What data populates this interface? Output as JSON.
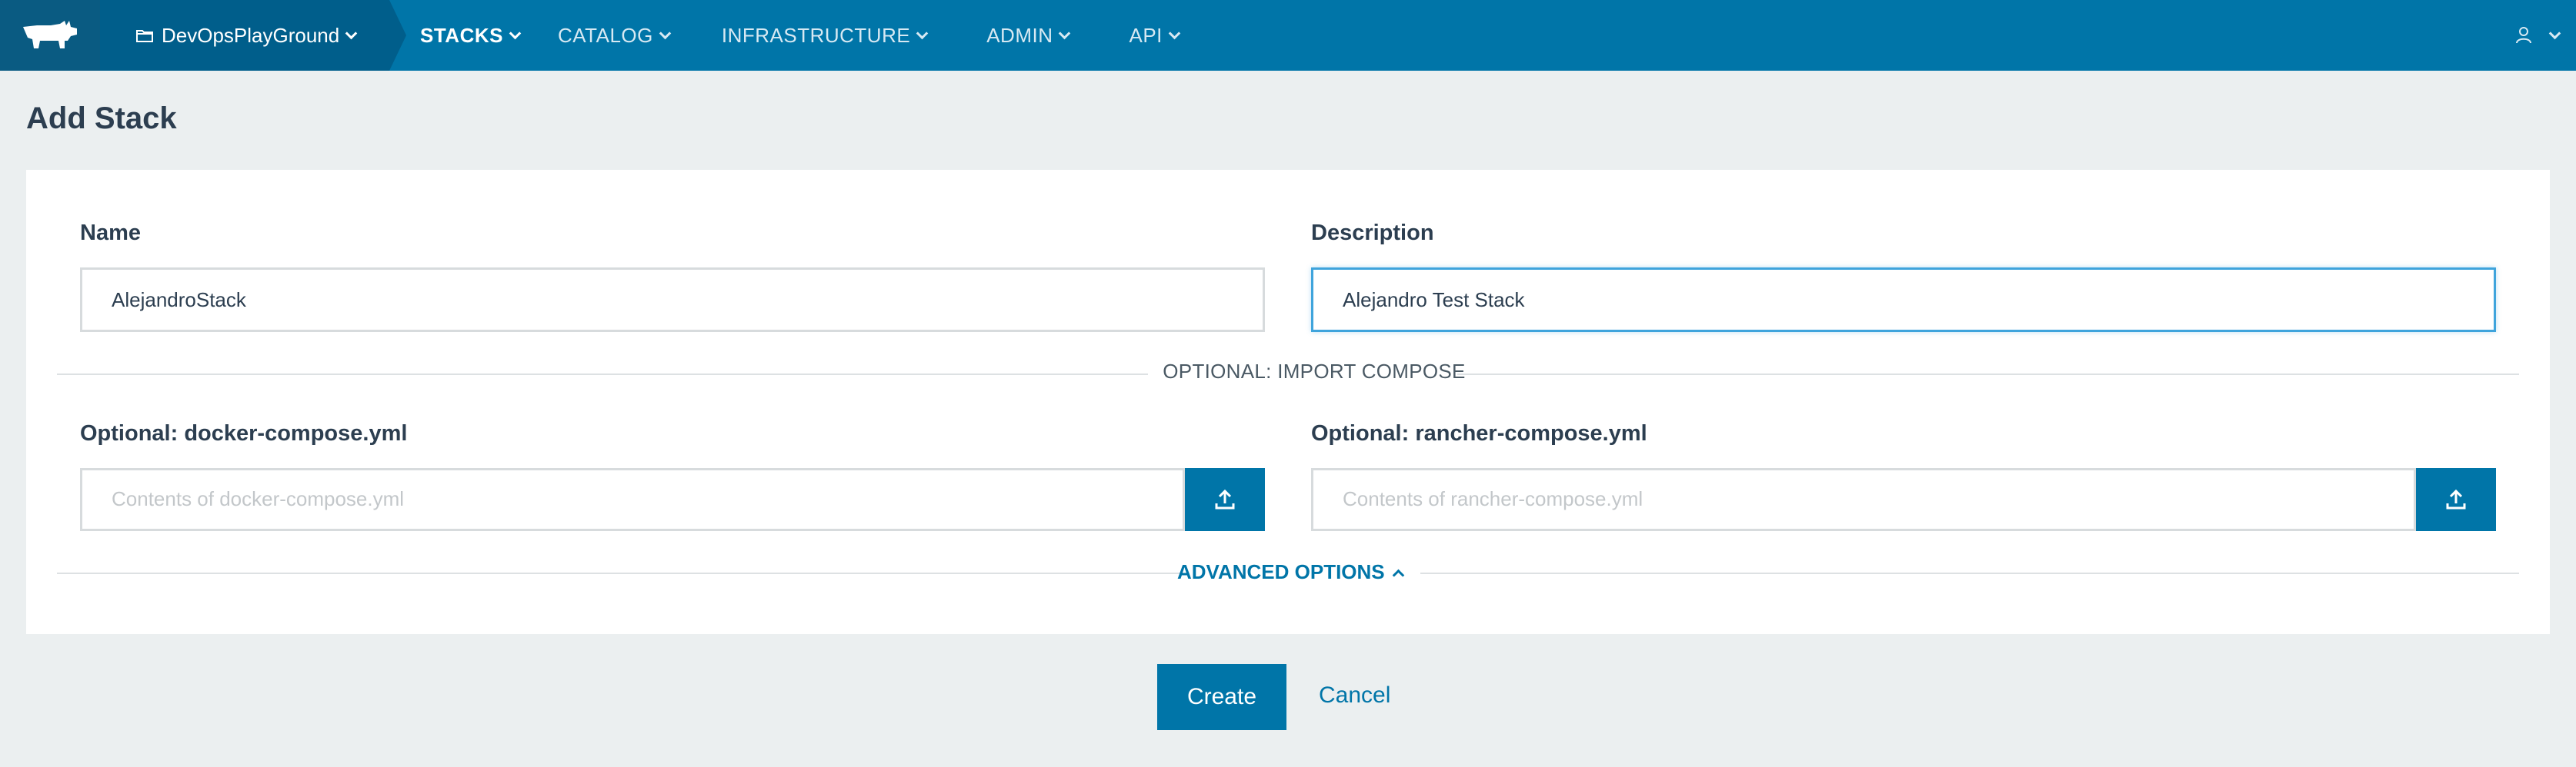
{
  "nav": {
    "environment": "DevOpsPlayGround",
    "menu": [
      {
        "label": "STACKS",
        "active": true
      },
      {
        "label": "CATALOG",
        "active": false
      },
      {
        "label": "INFRASTRUCTURE",
        "active": false
      },
      {
        "label": "ADMIN",
        "active": false
      },
      {
        "label": "API",
        "active": false
      }
    ],
    "colors": {
      "bar": "#0075a8",
      "env": "#005e8b",
      "logo": "#0a5b82"
    }
  },
  "page": {
    "title": "Add Stack"
  },
  "form": {
    "name": {
      "label": "Name",
      "value": "AlejandroStack"
    },
    "description": {
      "label": "Description",
      "value": "Alejandro Test Stack"
    },
    "import_divider": "OPTIONAL: IMPORT COMPOSE",
    "docker_compose": {
      "label": "Optional: docker-compose.yml",
      "placeholder": "Contents of docker-compose.yml",
      "value": ""
    },
    "rancher_compose": {
      "label": "Optional: rancher-compose.yml",
      "placeholder": "Contents of rancher-compose.yml",
      "value": ""
    },
    "advanced": "ADVANCED OPTIONS"
  },
  "actions": {
    "create": "Create",
    "cancel": "Cancel"
  }
}
